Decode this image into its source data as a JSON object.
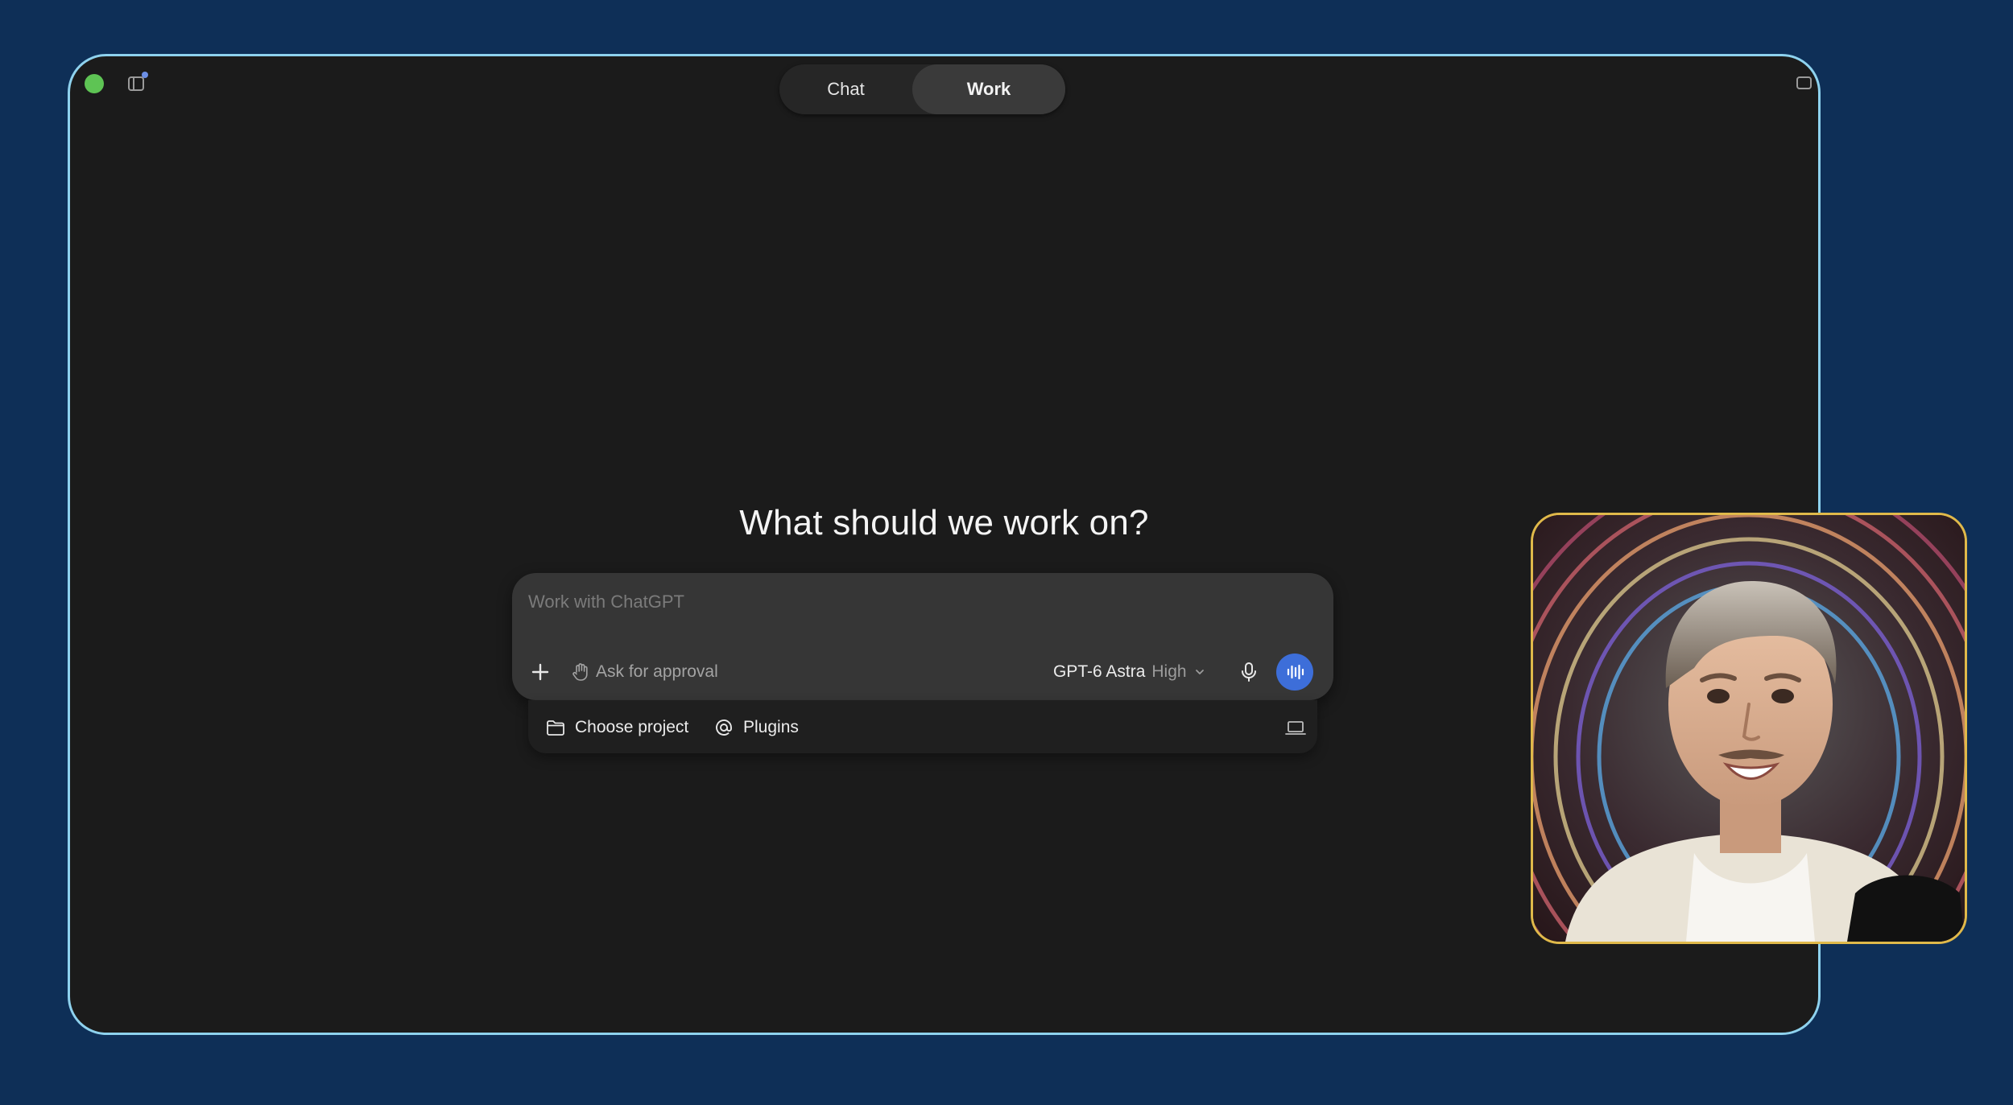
{
  "window": {
    "mode_tabs": [
      {
        "label": "Chat",
        "active": false
      },
      {
        "label": "Work",
        "active": true
      }
    ]
  },
  "main": {
    "headline": "What should we work on?"
  },
  "composer": {
    "placeholder": "Work with ChatGPT",
    "value": "",
    "approval_label": "Ask for approval",
    "model_name": "GPT-6 Astra",
    "model_effort": "High",
    "footer": {
      "project_label": "Choose project",
      "plugins_label": "Plugins"
    }
  },
  "colors": {
    "background": "#0e2f57",
    "window_bg": "#1b1b1b",
    "window_border": "#8ed2ee",
    "traffic_light_green": "#5ec454",
    "voice_button": "#3d6ed9",
    "presenter_border": "#e0b94a"
  },
  "icons": {
    "sidebar_toggle": "sidebar-toggle-icon",
    "plus": "plus-icon",
    "approval": "hand-icon",
    "model_dropdown": "chevron-down-icon",
    "mic": "microphone-icon",
    "voice": "voice-waveform-icon",
    "project": "folder-icon",
    "plugins": "at-sign-icon",
    "laptop": "laptop-icon"
  }
}
